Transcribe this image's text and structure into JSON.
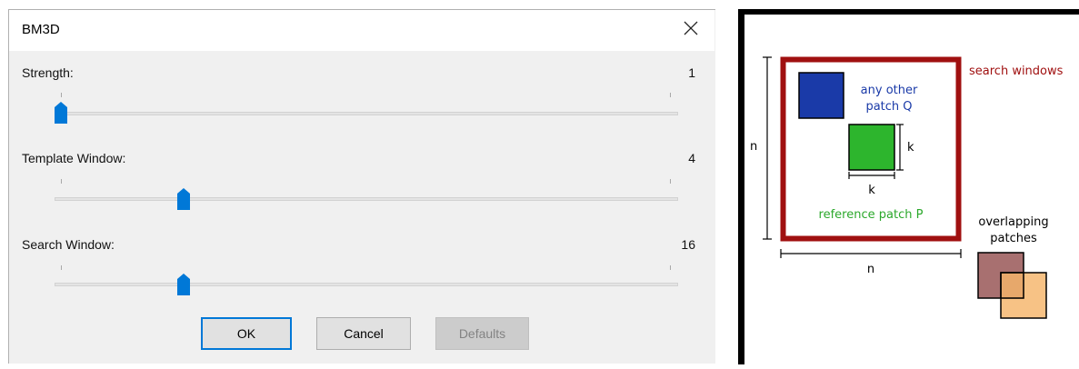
{
  "dialog": {
    "title": "BM3D",
    "sliders": [
      {
        "label": "Strength:",
        "value": "1",
        "level": 0.0
      },
      {
        "label": "Template Window:",
        "value": "4",
        "level": 0.2
      },
      {
        "label": "Search Window:",
        "value": "16",
        "level": 0.2
      }
    ],
    "buttons": {
      "ok": "OK",
      "cancel": "Cancel",
      "defaults": "Defaults"
    },
    "accent_color": "#0078d7"
  },
  "diagram": {
    "search_windows_label": "search windows",
    "other_patch_line1": "any other",
    "other_patch_line2": "patch Q",
    "reference_patch_label": "reference patch P",
    "k_label": "k",
    "n_label": "n",
    "overlapping_line1": "overlapping",
    "overlapping_line2": "patches",
    "colors": {
      "search_window": "#a01010",
      "patch_q": "#1a3aa8",
      "patch_p": "#2db52d",
      "reference_text": "#2ba82b",
      "overlap_back": "#a87070",
      "overlap_front": "#f5b56a"
    }
  }
}
